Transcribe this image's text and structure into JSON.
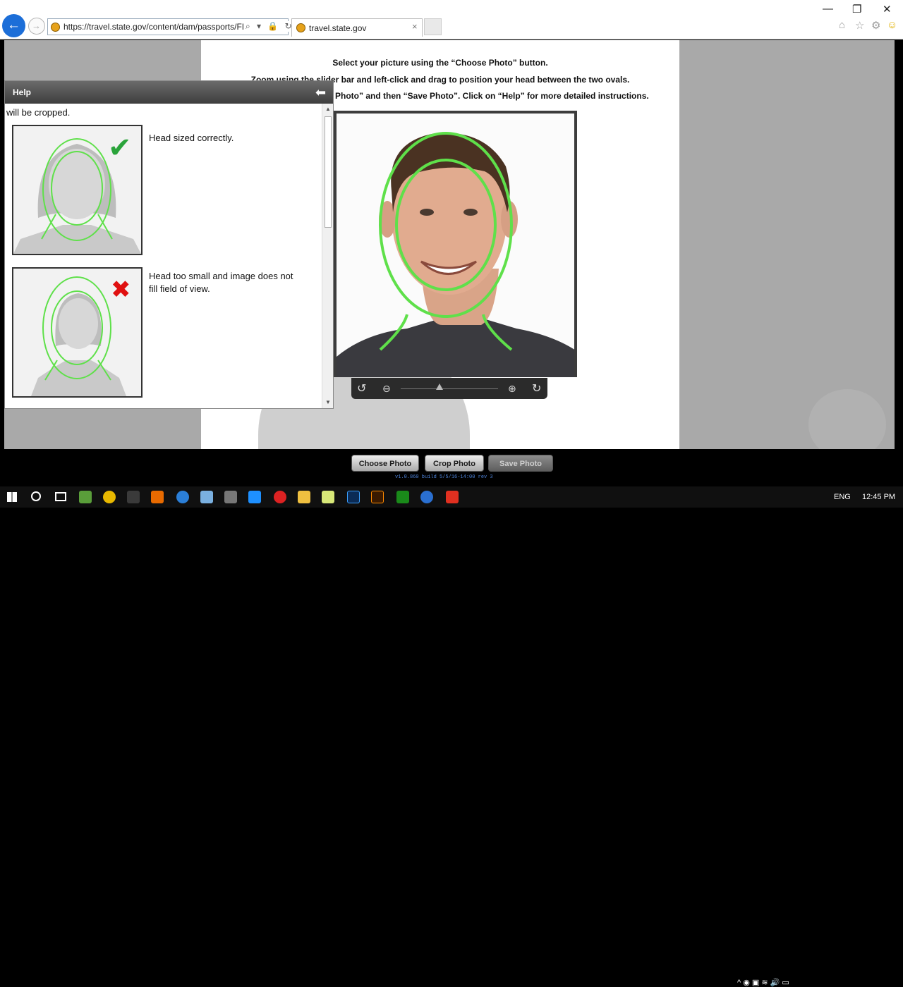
{
  "browser": {
    "url": "https://travel.state.gov/content/dam/passports/FIC",
    "tab_title": "travel.state.gov",
    "tab_close": "×",
    "back_glyph": "←",
    "forward_glyph": "→",
    "addr_icons": "⌕ ▾ 🔒 ↻",
    "window_controls": {
      "minimize": "—",
      "restore": "❐",
      "close": "✕"
    },
    "tool_icons": {
      "home": "⌂",
      "favorites": "☆",
      "settings": "⚙",
      "feedback": "☺"
    }
  },
  "instructions": {
    "line1": "Select your picture using the “Choose Photo” button.",
    "line2": "Zoom using the slider bar and left-click and drag to position your head between the two ovals.",
    "line3": "Photo” and then “Save Photo”.  Click on “Help” for more detailed instructions."
  },
  "slider": {
    "rotate_left": "↺",
    "zoom_out": "⊖",
    "zoom_in": "⊕",
    "rotate_right": "↻",
    "zoom_level": 0.4
  },
  "help": {
    "title": "Help",
    "back_glyph": "⬅",
    "intro_tail": "will be cropped.",
    "examples": [
      {
        "caption": "Head sized correctly.",
        "mark": "✔",
        "mark_color": "#2aa33a"
      },
      {
        "caption": "Head too small and image does not fill field of view.",
        "mark": "✖",
        "mark_color": "#e01010"
      }
    ],
    "scroll_up": "▲",
    "scroll_down": "▼"
  },
  "buttons": {
    "choose_photo": "Choose Photo",
    "crop_photo": "Crop Photo",
    "save_photo": "Save Photo"
  },
  "build_info": "v1.0.860 build 5/5/16-14:00 rev 3",
  "taskbar": {
    "language": "ENG",
    "time": "12:45 PM",
    "tray_icons": "^  ◉  ▣  ≋  🔊  ▭"
  },
  "colors": {
    "oval_green": "#5fe04a",
    "accent_blue": "#1c6ed8"
  }
}
